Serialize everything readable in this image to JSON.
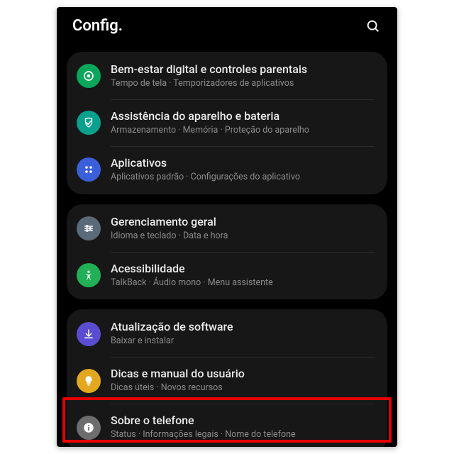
{
  "header": {
    "title": "Config."
  },
  "groups": [
    {
      "items": [
        {
          "title": "Bem-estar digital e controles parentais",
          "sub": "Tempo de tela  ·  Temporizadores de aplicativos"
        },
        {
          "title": "Assistência do aparelho e bateria",
          "sub": "Armazenamento  ·  Memória  ·  Proteção do aparelho"
        },
        {
          "title": "Aplicativos",
          "sub": "Aplicativos padrão  ·  Configurações do aplicativo"
        }
      ]
    },
    {
      "items": [
        {
          "title": "Gerenciamento geral",
          "sub": "Idioma e teclado  ·  Data e hora"
        },
        {
          "title": "Acessibilidade",
          "sub": "TalkBack  ·  Áudio mono  ·  Menu assistente"
        }
      ]
    },
    {
      "items": [
        {
          "title": "Atualização de software",
          "sub": "Baixar e instalar"
        },
        {
          "title": "Dicas e manual do usuário",
          "sub": "Dicas úteis  ·  Novos recursos"
        },
        {
          "title": "Sobre o telefone",
          "sub": "Status  ·  Informações legais  ·  Nome do telefone"
        }
      ]
    }
  ],
  "highlight": {
    "target": "about-phone"
  }
}
